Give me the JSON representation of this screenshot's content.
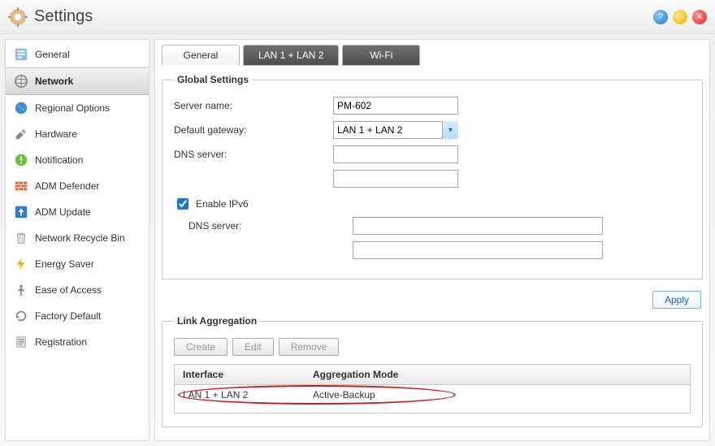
{
  "window": {
    "title": "Settings"
  },
  "titlebar_icons": {
    "help": "?",
    "minimize": "–",
    "close": "✕"
  },
  "sidebar": {
    "items": [
      {
        "label": "General"
      },
      {
        "label": "Network"
      },
      {
        "label": "Regional Options"
      },
      {
        "label": "Hardware"
      },
      {
        "label": "Notification"
      },
      {
        "label": "ADM Defender"
      },
      {
        "label": "ADM Update"
      },
      {
        "label": "Network Recycle Bin"
      },
      {
        "label": "Energy Saver"
      },
      {
        "label": "Ease of Access"
      },
      {
        "label": "Factory Default"
      },
      {
        "label": "Registration"
      }
    ],
    "active_index": 1
  },
  "tabs": {
    "items": [
      {
        "label": "General"
      },
      {
        "label": "LAN 1 + LAN 2"
      },
      {
        "label": "Wi-Fi"
      }
    ],
    "active_index": 0
  },
  "global_settings": {
    "legend": "Global Settings",
    "server_name_label": "Server name:",
    "server_name_value": "PM-602",
    "gateway_label": "Default gateway:",
    "gateway_value": "LAN 1 + LAN 2",
    "dns_label": "DNS server:",
    "dns1": "",
    "dns2": "",
    "ipv6_label": "Enable IPv6",
    "ipv6_checked": true,
    "ipv6_dns_label": "DNS server:",
    "ipv6_dns1": "",
    "ipv6_dns2": ""
  },
  "apply_label": "Apply",
  "link_aggregation": {
    "legend": "Link Aggregation",
    "create_label": "Create",
    "edit_label": "Edit",
    "remove_label": "Remove",
    "col_interface": "Interface",
    "col_mode": "Aggregation Mode",
    "rows": [
      {
        "interface": "LAN 1 + LAN 2",
        "mode": "Active-Backup"
      }
    ]
  }
}
